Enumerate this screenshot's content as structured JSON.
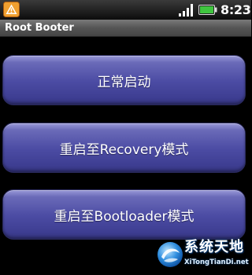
{
  "status_bar": {
    "notification_icon": "warning-triangle-icon",
    "signal_icon": "signal-bars-icon",
    "battery_icon": "battery-icon",
    "time": "8:23"
  },
  "app": {
    "title": "Root Booter"
  },
  "buttons": [
    {
      "label": "正常启动"
    },
    {
      "label": "重启至Recovery模式"
    },
    {
      "label": "重启至Bootloader模式"
    }
  ],
  "watermark": {
    "title": "系统天地",
    "url": "XiTongTianDi.net"
  },
  "colors": {
    "background": "#000000",
    "button_top": "#9a9ad8",
    "button_bottom": "#33337c",
    "battery_fill": "#3fc53f"
  }
}
